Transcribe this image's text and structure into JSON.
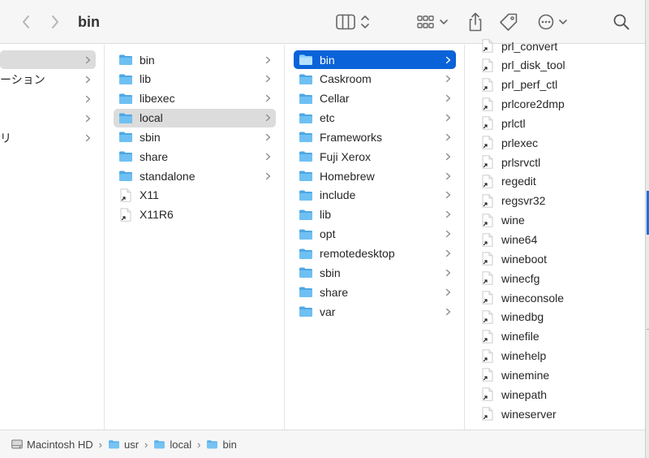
{
  "window": {
    "title": "bin"
  },
  "colors": {
    "accent": "#0a63d8",
    "folder": "#5bb0ea"
  },
  "toolbar": {
    "back_icon": "chevron-left-icon",
    "forward_icon": "chevron-right-icon",
    "view_icon": "column-view-icon",
    "group_icon": "group-grid-icon",
    "share_icon": "share-icon",
    "tag_icon": "tag-icon",
    "action_icon": "more-actions-icon",
    "search_icon": "search-icon"
  },
  "columns": [
    {
      "items": [
        {
          "label": "",
          "type": "folder-partial",
          "selected": "gray",
          "chevron": true
        },
        {
          "label": "ーション",
          "type": "text-partial",
          "chevron": true
        },
        {
          "label": "",
          "type": "text-partial",
          "chevron": true
        },
        {
          "label": "",
          "type": "text-partial",
          "chevron": true
        },
        {
          "label": "リ",
          "type": "text-partial",
          "chevron": true
        }
      ]
    },
    {
      "items": [
        {
          "label": "bin",
          "type": "folder",
          "chevron": true
        },
        {
          "label": "lib",
          "type": "folder",
          "chevron": true
        },
        {
          "label": "libexec",
          "type": "folder",
          "chevron": true
        },
        {
          "label": "local",
          "type": "folder",
          "selected": "gray",
          "chevron": true
        },
        {
          "label": "sbin",
          "type": "folder",
          "chevron": true
        },
        {
          "label": "share",
          "type": "folder",
          "chevron": true
        },
        {
          "label": "standalone",
          "type": "folder",
          "chevron": true
        },
        {
          "label": "X11",
          "type": "alias"
        },
        {
          "label": "X11R6",
          "type": "alias"
        }
      ]
    },
    {
      "items": [
        {
          "label": "bin",
          "type": "folder",
          "selected": "blue",
          "chevron": true
        },
        {
          "label": "Caskroom",
          "type": "folder",
          "chevron": true
        },
        {
          "label": "Cellar",
          "type": "folder",
          "chevron": true
        },
        {
          "label": "etc",
          "type": "folder",
          "chevron": true
        },
        {
          "label": "Frameworks",
          "type": "folder",
          "chevron": true
        },
        {
          "label": "Fuji Xerox",
          "type": "folder",
          "chevron": true
        },
        {
          "label": "Homebrew",
          "type": "folder",
          "chevron": true
        },
        {
          "label": "include",
          "type": "folder",
          "chevron": true
        },
        {
          "label": "lib",
          "type": "folder",
          "chevron": true
        },
        {
          "label": "opt",
          "type": "folder",
          "chevron": true
        },
        {
          "label": "remotedesktop",
          "type": "folder",
          "chevron": true
        },
        {
          "label": "sbin",
          "type": "folder",
          "chevron": true
        },
        {
          "label": "share",
          "type": "folder",
          "chevron": true
        },
        {
          "label": "var",
          "type": "folder",
          "chevron": true
        }
      ]
    },
    {
      "items": [
        {
          "label": "prl_convert",
          "type": "alias"
        },
        {
          "label": "prl_disk_tool",
          "type": "alias"
        },
        {
          "label": "prl_perf_ctl",
          "type": "alias"
        },
        {
          "label": "prlcore2dmp",
          "type": "alias"
        },
        {
          "label": "prlctl",
          "type": "alias"
        },
        {
          "label": "prlexec",
          "type": "alias"
        },
        {
          "label": "prlsrvctl",
          "type": "alias"
        },
        {
          "label": "regedit",
          "type": "alias"
        },
        {
          "label": "regsvr32",
          "type": "alias"
        },
        {
          "label": "wine",
          "type": "alias"
        },
        {
          "label": "wine64",
          "type": "alias"
        },
        {
          "label": "wineboot",
          "type": "alias"
        },
        {
          "label": "winecfg",
          "type": "alias"
        },
        {
          "label": "wineconsole",
          "type": "alias"
        },
        {
          "label": "winedbg",
          "type": "alias"
        },
        {
          "label": "winefile",
          "type": "alias"
        },
        {
          "label": "winehelp",
          "type": "alias"
        },
        {
          "label": "winemine",
          "type": "alias"
        },
        {
          "label": "winepath",
          "type": "alias"
        },
        {
          "label": "wineserver",
          "type": "alias"
        }
      ]
    }
  ],
  "pathbar": {
    "crumbs": [
      {
        "label": "Macintosh HD",
        "icon": "hard-drive-icon"
      },
      {
        "label": "usr",
        "icon": "folder-icon"
      },
      {
        "label": "local",
        "icon": "folder-icon"
      },
      {
        "label": "bin",
        "icon": "folder-icon"
      }
    ]
  }
}
